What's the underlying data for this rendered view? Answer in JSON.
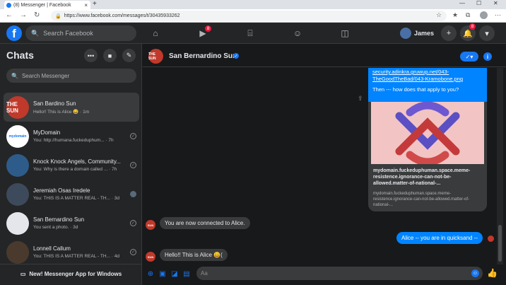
{
  "browser": {
    "tab_title": "(8) Messenger | Facebook",
    "url": "https://www.facebook.com/messages/t/30435933262",
    "new_tab": "+",
    "close_tab": "×"
  },
  "fb_nav": {
    "search_placeholder": "Search Facebook",
    "watch_badge": "8",
    "notifications_badge": "8",
    "user_name": "James"
  },
  "sidebar": {
    "title": "Chats",
    "search_placeholder": "Search Messenger",
    "footer": "New! Messenger App for Windows",
    "conversations": [
      {
        "name": "San Bardino Sun",
        "preview": "Hello!! This is Alice 😀 · 1m",
        "active": true
      },
      {
        "name": "MyDomain",
        "preview": "You: http://humana.fuckeduphum... · 7h"
      },
      {
        "name": "Knock Knock Angels, Community...",
        "preview": "You: Why is there a domain called ... · 7h"
      },
      {
        "name": "Jeremiah Osas Iredele",
        "preview": "You: THIS IS A MATTER REAL - TH... · 3d"
      },
      {
        "name": "San Bernardino Sun",
        "preview": "You sent a photo. · 3d"
      },
      {
        "name": "Lonnell Callum",
        "preview": "You: THIS IS A MATTER REAL - TH... · 4d"
      }
    ]
  },
  "chat": {
    "name": "San Bernardino Sun",
    "avatar_text": "THE SUN",
    "link_line1": "security.adinkra.gruwup.net/043-",
    "link_line2": "TheGoodTheBad/043-Kramobone.png",
    "then_text": "Then --- how does that apply to you?",
    "preview_title": "mydomain.fuckeduphuman.space.meme-resistence.ignorance-can-not-be-allowed.matter-of-national-...",
    "preview_desc": "mydomain.fuckeduphuman.space.meme-resistence.ignorance-can-not-be-allowed.matter-of-national-...",
    "connected_msg": "You are now connected to Alice.",
    "outgoing_msg": "Alice -- you are in quicksand --",
    "hello_msg": "Hello!! This is Alice 😀(",
    "input_placeholder": "Aa"
  },
  "colors": {
    "accent": "#1877f2",
    "bubble": "#0084ff",
    "bg": "#18191a",
    "panel": "#242526"
  }
}
